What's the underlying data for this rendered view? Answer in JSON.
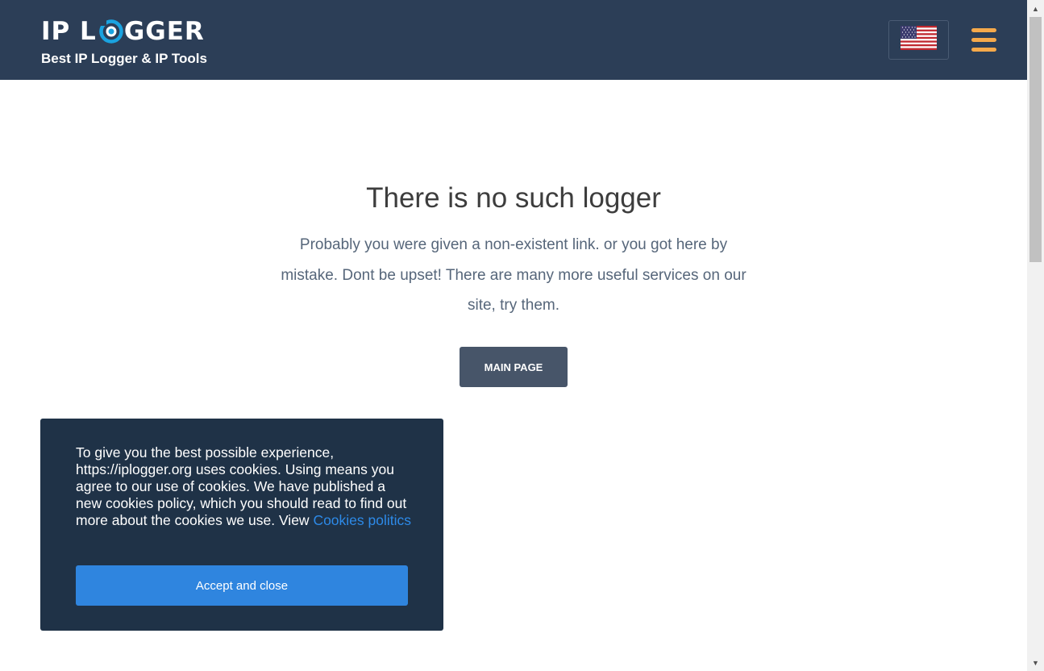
{
  "header": {
    "logo_left": "IP L",
    "logo_right": "GGER",
    "logo_icon": "eye-o-icon",
    "tagline": "Best IP Logger & IP Tools",
    "language_icon": "us-flag-icon",
    "menu_icon": "hamburger-menu-icon",
    "colors": {
      "background": "#2c3e57",
      "accent": "#f5a94b",
      "logo_blue": "#1aa3e0"
    }
  },
  "main": {
    "title": "There is no such logger",
    "description": "Probably you were given a non-existent link. or you got here by mistake. Dont be upset! There are many more useful services on our site, try them.",
    "button_label": "MAIN PAGE"
  },
  "cookie_banner": {
    "text": "To give you the best possible experience, https://iplogger.org uses cookies. Using means you agree to our use of cookies. We have published a new cookies policy, which you should read to find out more about the cookies we use. View ",
    "link_text": "Cookies politics",
    "accept_label": "Accept and close",
    "colors": {
      "background": "#1f3247",
      "button": "#2f85df",
      "link": "#2d8ae8"
    }
  },
  "scrollbar": {
    "up_icon": "scroll-up-arrow-icon",
    "down_icon": "scroll-down-arrow-icon"
  }
}
